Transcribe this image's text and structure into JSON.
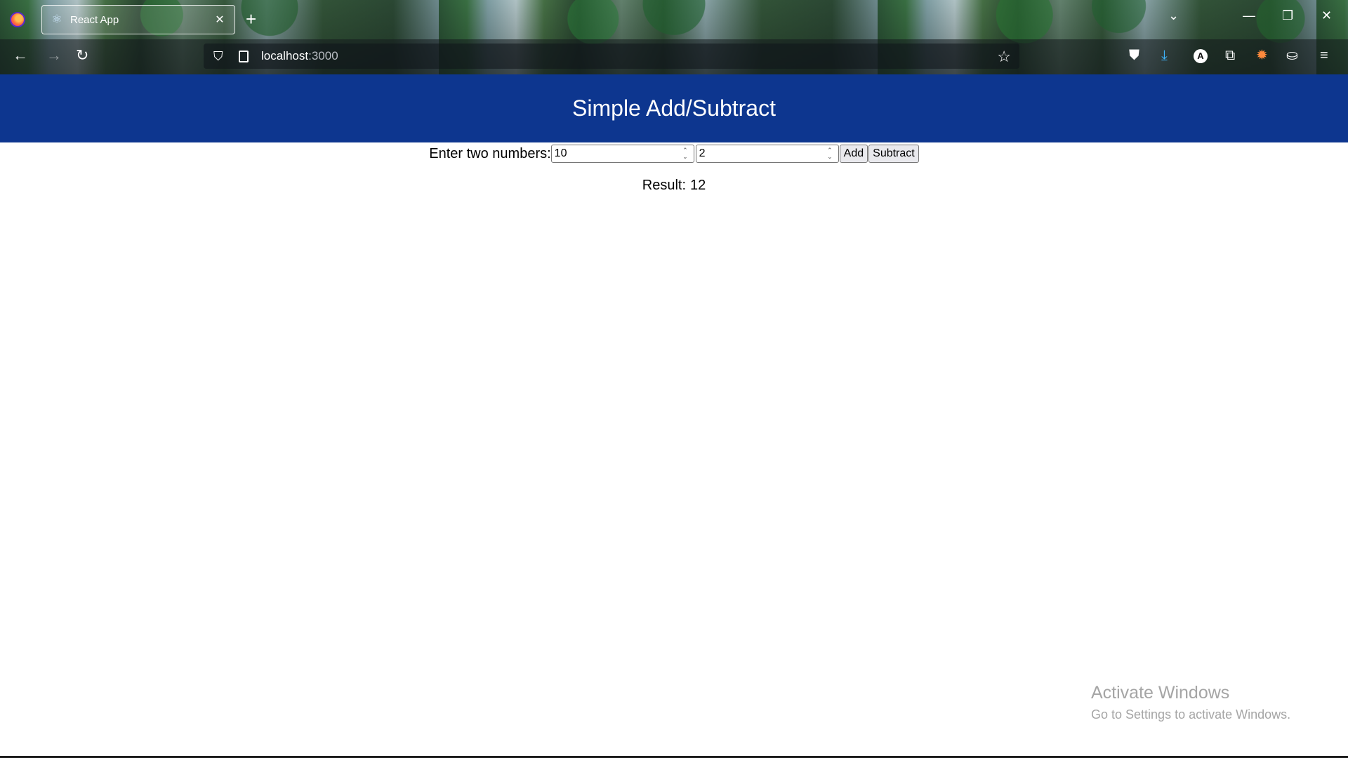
{
  "browser": {
    "tab": {
      "title": "React App",
      "favicon": "react-icon",
      "close": "✕"
    },
    "new_tab": "+",
    "url": {
      "host": "localhost",
      "port": ":3000"
    }
  },
  "app": {
    "header_title": "Simple Add/Subtract",
    "prompt": "Enter two numbers:",
    "inputs": [
      "10",
      "2"
    ],
    "add_label": "Add",
    "subtract_label": "Subtract",
    "result_label": "Result:",
    "result_value": "12",
    "header_color": "#0d368f"
  },
  "os": {
    "watermark_title": "Activate Windows",
    "watermark_subtitle": "Go to Settings to activate Windows."
  }
}
